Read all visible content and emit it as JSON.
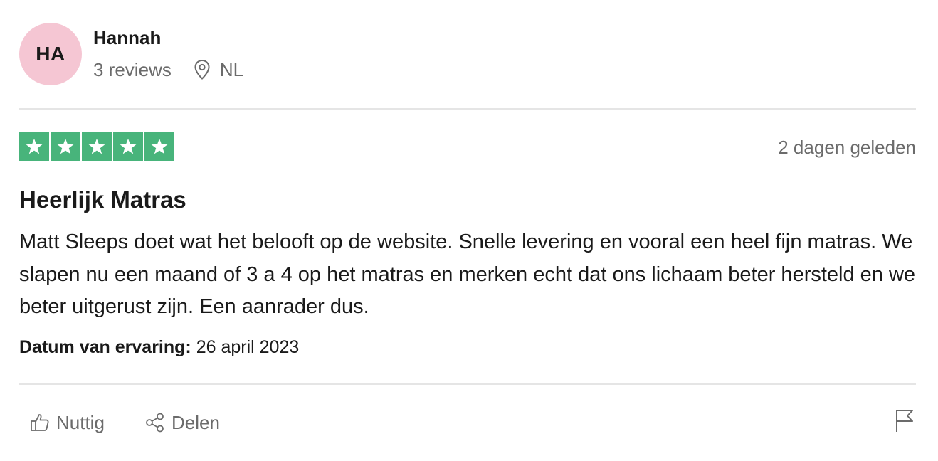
{
  "consumer": {
    "initials": "HA",
    "name": "Hannah",
    "reviews_count": "3 reviews",
    "country": "NL",
    "avatar_color": "#f5c6d3"
  },
  "review": {
    "rating": 5,
    "max_rating": 5,
    "star_color": "#48b47b",
    "date": "2 dagen geleden",
    "title": "Heerlijk Matras",
    "text": "Matt Sleeps doet wat het belooft op de website. Snelle levering en vooral een heel fijn matras. We slapen nu een maand of 3 a 4 op het matras en merken echt dat ons lichaam beter hersteld en we beter uitgerust zijn. Een aanrader dus.",
    "experience_label": "Datum van ervaring:",
    "experience_date": "26 april 2023"
  },
  "actions": {
    "useful_label": "Nuttig",
    "useful_icon": "thumbs-up-icon",
    "share_label": "Delen",
    "share_icon": "share-icon",
    "report_icon": "flag-icon"
  },
  "icons": {
    "location": "location-pin-icon",
    "star": "star-icon"
  }
}
